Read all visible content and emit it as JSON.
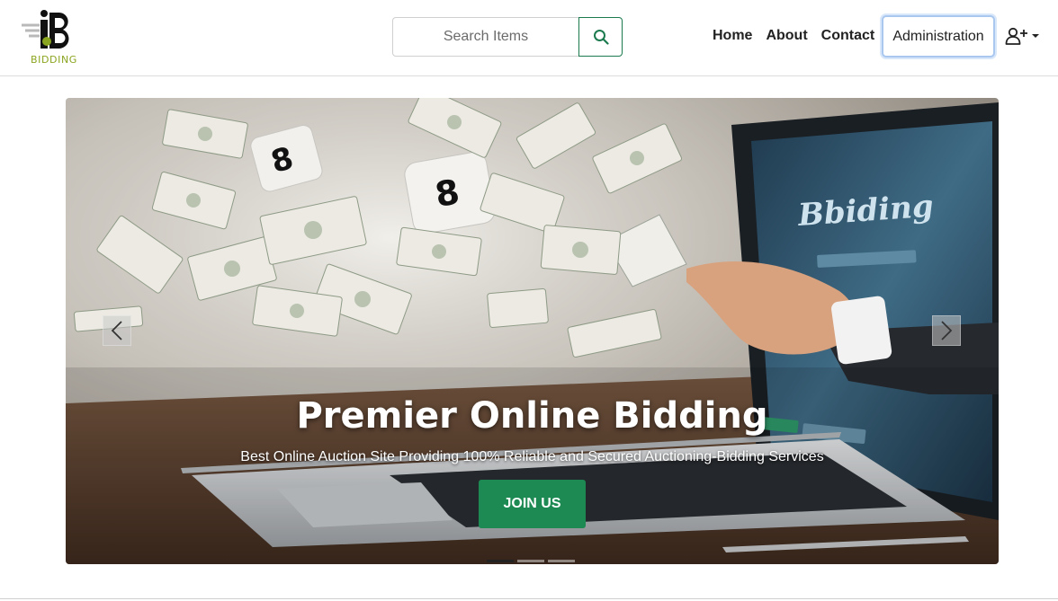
{
  "brand": {
    "logo_text": "BIDDING",
    "logo_green": "#8aa51f"
  },
  "search": {
    "placeholder": "Search Items",
    "icon": "search-icon"
  },
  "nav": {
    "links": [
      "Home",
      "About",
      "Contact"
    ],
    "admin_label": "Administration",
    "user_icon": "user-plus-icon",
    "dropdown_icon": "caret-down-icon"
  },
  "hero": {
    "title": "Premier Online Bidding",
    "subtitle": "Best Online Auction Site Providing 100% Reliable and Secured Auctioning-Bidding Services",
    "cta_label": "JOIN US",
    "screen_text": "Bbiding",
    "slides": 3,
    "active_slide": 1
  },
  "colors": {
    "accent": "#1d8a53",
    "admin_border": "#a9c7ef"
  }
}
